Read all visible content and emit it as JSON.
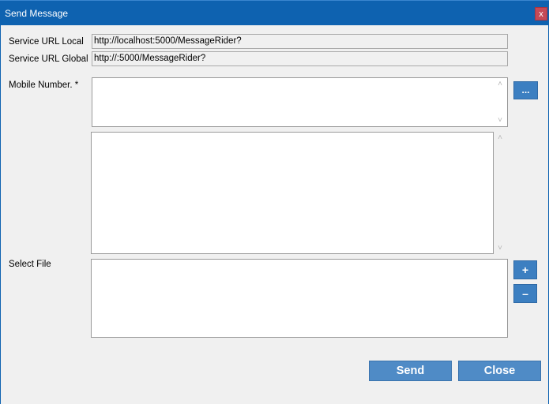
{
  "window": {
    "title": "Send Message",
    "close_glyph": "x"
  },
  "form": {
    "service_url_local_label": "Service URL Local",
    "service_url_local_value": "http://localhost:5000/MessageRider?",
    "service_url_global_label": "Service URL Global",
    "service_url_global_value": "http://:5000/MessageRider?",
    "mobile_number_label": "Mobile Number. *",
    "mobile_number_value": "",
    "message_value": "",
    "select_file_label": "Select File"
  },
  "buttons": {
    "browse_label": "...",
    "add_label": "+",
    "remove_label": "–",
    "send_label": "Send",
    "close_label": "Close"
  },
  "icons": {
    "scroll_up": "chevron-up-icon",
    "scroll_down": "chevron-down-icon"
  },
  "colors": {
    "titlebar": "#0e62b0",
    "button": "#4f8bc6",
    "close_button": "#c44a57"
  }
}
